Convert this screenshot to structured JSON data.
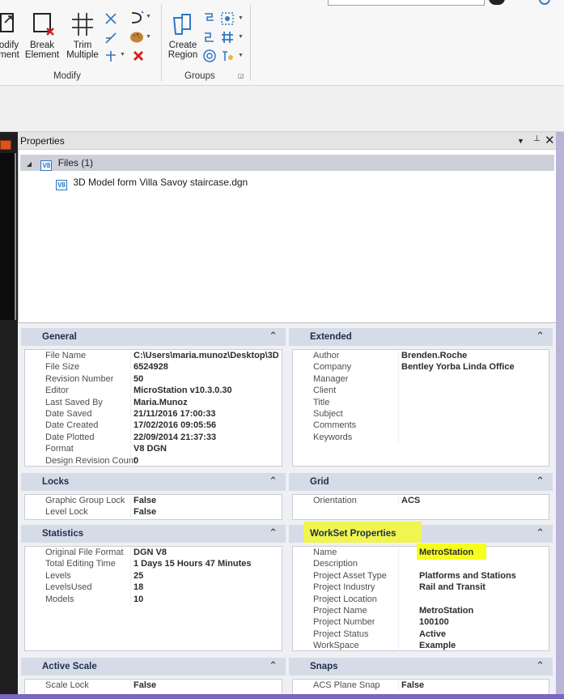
{
  "ribbon": {
    "buttons": [
      {
        "line1": "odify",
        "line2": "ment"
      },
      {
        "line1": "Break",
        "line2": "Element"
      },
      {
        "line1": "Trim",
        "line2": "Multiple"
      },
      {
        "line1": "Create",
        "line2": "Region"
      }
    ],
    "groups": {
      "modify": "Modify",
      "groups": "Groups"
    }
  },
  "properties": {
    "title": "Properties",
    "tree": {
      "root": "Files (1)",
      "file": "3D Model form Villa Savoy staircase.dgn",
      "badge": "V8"
    }
  },
  "sections": {
    "general": {
      "title": "General",
      "rows": [
        {
          "k": "File Name",
          "v": "C:\\Users\\maria.munoz\\Desktop\\3D"
        },
        {
          "k": "File Size",
          "v": "6524928"
        },
        {
          "k": "Revision Number",
          "v": "50"
        },
        {
          "k": "Editor",
          "v": "MicroStation v10.3.0.30"
        },
        {
          "k": "Last Saved By",
          "v": "Maria.Munoz"
        },
        {
          "k": "Date Saved",
          "v": "21/11/2016 17:00:33"
        },
        {
          "k": "Date Created",
          "v": "17/02/2016 09:05:56"
        },
        {
          "k": "Date Plotted",
          "v": "22/09/2014 21:37:33"
        },
        {
          "k": "Format",
          "v": "V8 DGN"
        },
        {
          "k": "Design Revision Count",
          "v": "0"
        }
      ]
    },
    "extended": {
      "title": "Extended",
      "rows": [
        {
          "k": "Author",
          "v": "Brenden.Roche"
        },
        {
          "k": "Company",
          "v": "Bentley Yorba Linda Office"
        },
        {
          "k": "Manager",
          "v": ""
        },
        {
          "k": "Client",
          "v": ""
        },
        {
          "k": "Title",
          "v": ""
        },
        {
          "k": "Subject",
          "v": ""
        },
        {
          "k": "Comments",
          "v": ""
        },
        {
          "k": "Keywords",
          "v": ""
        }
      ]
    },
    "locks": {
      "title": "Locks",
      "rows": [
        {
          "k": "Graphic Group Lock",
          "v": "False"
        },
        {
          "k": "Level Lock",
          "v": "False"
        }
      ]
    },
    "grid": {
      "title": "Grid",
      "rows": [
        {
          "k": "Orientation",
          "v": "ACS"
        }
      ]
    },
    "statistics": {
      "title": "Statistics",
      "rows": [
        {
          "k": "Original File Format",
          "v": "DGN V8"
        },
        {
          "k": "Total Editing Time",
          "v": "1 Days 15 Hours 47 Minutes"
        },
        {
          "k": "Levels",
          "v": "25"
        },
        {
          "k": "LevelsUsed",
          "v": "18"
        },
        {
          "k": "Models",
          "v": "10"
        }
      ]
    },
    "workset": {
      "title": "WorkSet Properties",
      "rows": [
        {
          "k": "Name",
          "v": "MetroStation"
        },
        {
          "k": "Description",
          "v": ""
        },
        {
          "k": "Project Asset Type",
          "v": "Platforms and Stations"
        },
        {
          "k": "Project Industry",
          "v": "Rail and Transit"
        },
        {
          "k": "Project Location",
          "v": ""
        },
        {
          "k": "Project Name",
          "v": "MetroStation"
        },
        {
          "k": "Project Number",
          "v": "100100"
        },
        {
          "k": "Project Status",
          "v": "Active"
        },
        {
          "k": "WorkSpace",
          "v": "Example"
        }
      ]
    },
    "activescale": {
      "title": "Active Scale",
      "rows": [
        {
          "k": "Scale Lock",
          "v": "False"
        }
      ]
    },
    "snaps": {
      "title": "Snaps",
      "rows": [
        {
          "k": "ACS Plane Snap",
          "v": "False"
        }
      ]
    }
  },
  "colors": {
    "highlight": "#f6ff1f",
    "section_header": "#d6dce7",
    "accent_blue": "#2f78c4",
    "delete_red": "#d9201e"
  }
}
